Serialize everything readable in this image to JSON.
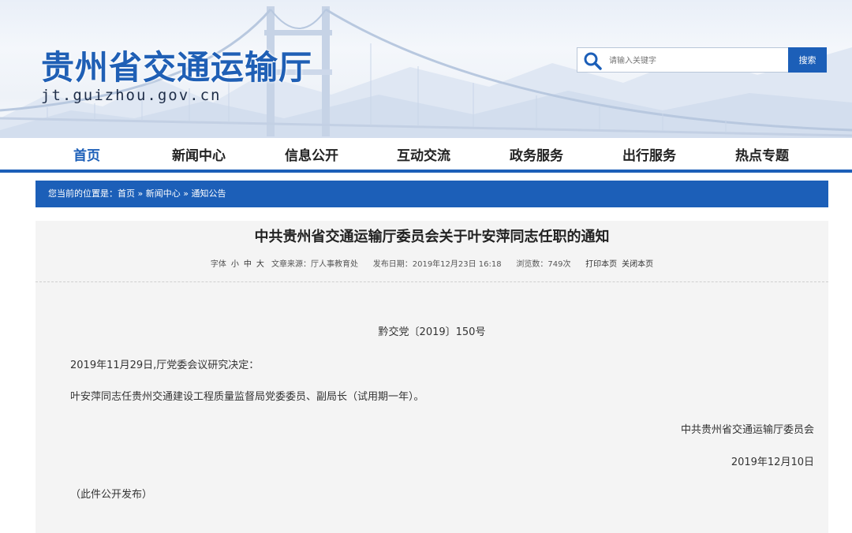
{
  "header": {
    "site_title": "贵州省交通运输厅",
    "site_domain": "jt.guizhou.gov.cn"
  },
  "search": {
    "placeholder": "请输入关键字",
    "button_label": "搜索",
    "icon": "search-icon"
  },
  "nav": {
    "items": [
      {
        "label": "首页",
        "active": true
      },
      {
        "label": "新闻中心"
      },
      {
        "label": "信息公开"
      },
      {
        "label": "互动交流"
      },
      {
        "label": "政务服务"
      },
      {
        "label": "出行服务"
      },
      {
        "label": "热点专题"
      }
    ]
  },
  "breadcrumb": {
    "prefix": "您当前的位置是：",
    "items": [
      "首页",
      "新闻中心",
      "通知公告"
    ],
    "separator": "»"
  },
  "article": {
    "title": "中共贵州省交通运输厅委员会关于叶安萍同志任职的通知",
    "meta": {
      "font_label": "字体",
      "font_small": "小",
      "font_medium": "中",
      "font_large": "大",
      "source": "文章来源：厅人事教育处",
      "date": "发布日期：2019年12月23日 16:18",
      "views": "浏览数：749次",
      "print": "打印本页",
      "close": "关闭本页"
    },
    "doc_number": "黔交党〔2019〕150号",
    "paragraph1": "2019年11月29日,厅党委会议研究决定：",
    "paragraph2": "叶安萍同志任贵州交通建设工程质量监督局党委委员、副局长（试用期一年）。",
    "signature": "中共贵州省交通运输厅委员会",
    "sign_date": "2019年12月10日",
    "note": "（此件公开发布）"
  },
  "colors": {
    "brand_blue": "#1c5fb8",
    "title_blue": "#1f5fb5",
    "article_bg": "#f4f4f4"
  }
}
